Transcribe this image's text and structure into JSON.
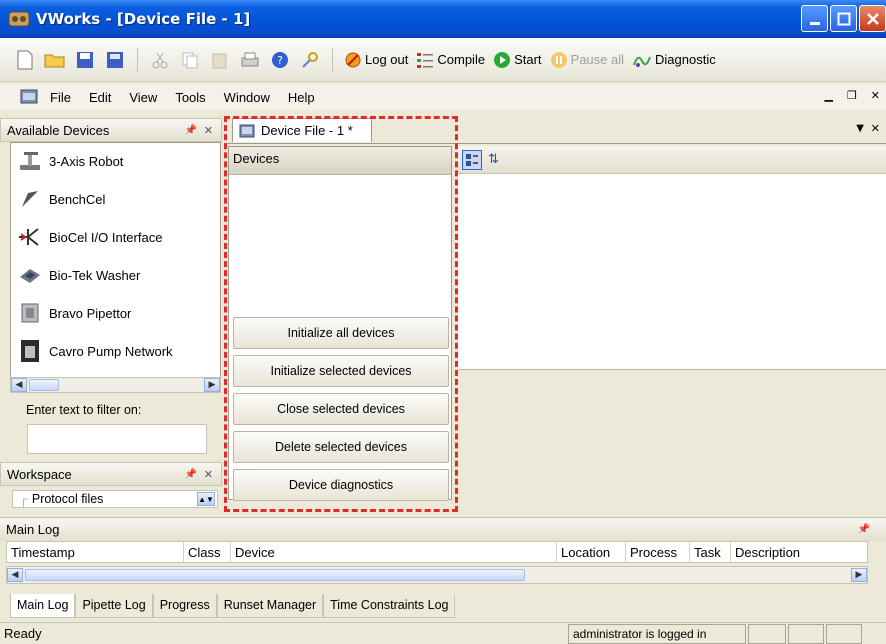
{
  "window": {
    "title": "VWorks - [Device File - 1]"
  },
  "toolbar": {
    "logout_label": "Log out",
    "compile_label": "Compile",
    "start_label": "Start",
    "pause_label": "Pause all",
    "diagnostics_label": "Diagnostic"
  },
  "menu": {
    "items": [
      "File",
      "Edit",
      "View",
      "Tools",
      "Window",
      "Help"
    ]
  },
  "available_devices": {
    "title": "Available Devices",
    "items": [
      "3-Axis Robot",
      "BenchCel",
      "BioCel I/O Interface",
      "Bio-Tek Washer",
      "Bravo Pipettor",
      "Cavro Pump Network"
    ],
    "filter_label": "Enter text to filter on:",
    "filter_value": ""
  },
  "workspace": {
    "title": "Workspace",
    "item": "Protocol files"
  },
  "document": {
    "tab_label": "Device File - 1 *"
  },
  "devices_panel": {
    "header": "Devices",
    "buttons": [
      "Initialize all devices",
      "Initialize selected devices",
      "Close selected devices",
      "Delete selected devices",
      "Device diagnostics"
    ]
  },
  "main_log": {
    "title": "Main Log",
    "columns": [
      "Timestamp",
      "Class",
      "Device",
      "Location",
      "Process",
      "Task",
      "Description"
    ]
  },
  "bottom_tabs": [
    "Main Log",
    "Pipette Log",
    "Progress",
    "Runset Manager",
    "Time Constraints Log"
  ],
  "status": {
    "ready": "Ready",
    "user": "administrator is logged in"
  },
  "colors": {
    "title_blue": "#0254d6",
    "highlight_red": "#e12a2a"
  }
}
